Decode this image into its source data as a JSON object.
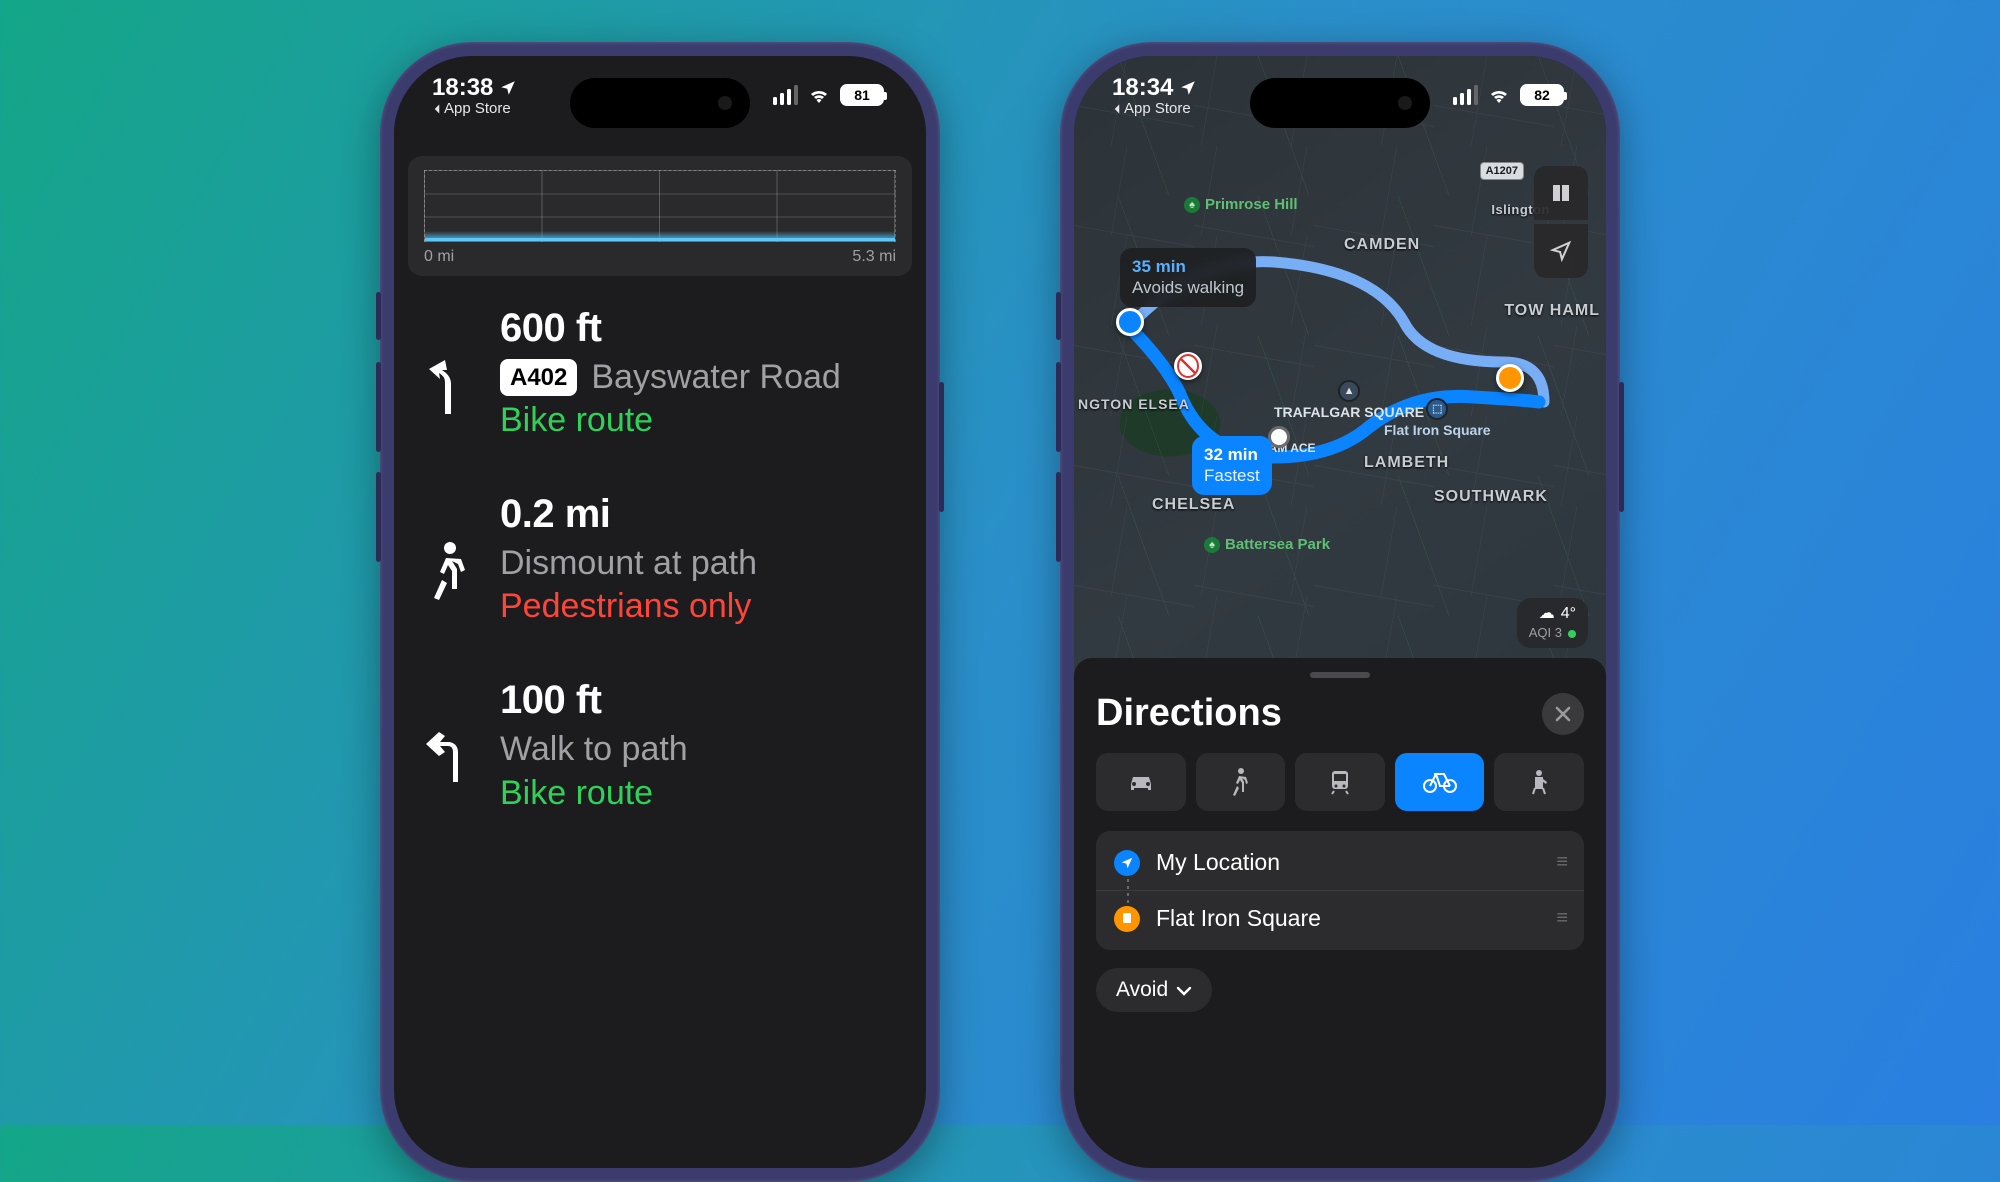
{
  "phone1": {
    "status": {
      "time": "18:38",
      "back_app": "App Store",
      "battery": "81"
    },
    "elevation": {
      "start": "0 mi",
      "end": "5.3 mi"
    },
    "steps": [
      {
        "distance": "600 ft",
        "road_badge": "A402",
        "road": "Bayswater Road",
        "sub": "Bike route",
        "sub_color": "green",
        "icon": "bear-left"
      },
      {
        "distance": "0.2 mi",
        "road": "Dismount at path",
        "sub": "Pedestrians only",
        "sub_color": "red",
        "icon": "walk"
      },
      {
        "distance": "100 ft",
        "road": "Walk to path",
        "sub": "Bike route",
        "sub_color": "green",
        "icon": "turn-left"
      }
    ]
  },
  "phone2": {
    "status": {
      "time": "18:34",
      "back_app": "App Store",
      "battery": "82"
    },
    "map": {
      "road_shield": "A1207",
      "district_labels": [
        "CAMDEN",
        "Islington",
        "TOW HAML",
        "LAMBETH",
        "SOUTHWARK",
        "CHELSEA",
        "NGTON ELSEA"
      ],
      "park_labels": [
        "Primrose Hill",
        "Battersea Park"
      ],
      "poi": {
        "trafalgar": "TRAFALGAR SQUARE",
        "ngham": "NGHAM ACE"
      },
      "destination": "Flat Iron Square",
      "callout_alt": {
        "time": "35 min",
        "note": "Avoids walking"
      },
      "callout_main": {
        "time": "32 min",
        "note": "Fastest"
      },
      "weather": {
        "temp": "4°",
        "aqi": "AQI 3"
      }
    },
    "sheet": {
      "title": "Directions",
      "modes": [
        "car",
        "walk",
        "transit",
        "bike",
        "hail"
      ],
      "active_mode": "bike",
      "from": "My Location",
      "to": "Flat Iron Square",
      "avoid_label": "Avoid"
    }
  }
}
